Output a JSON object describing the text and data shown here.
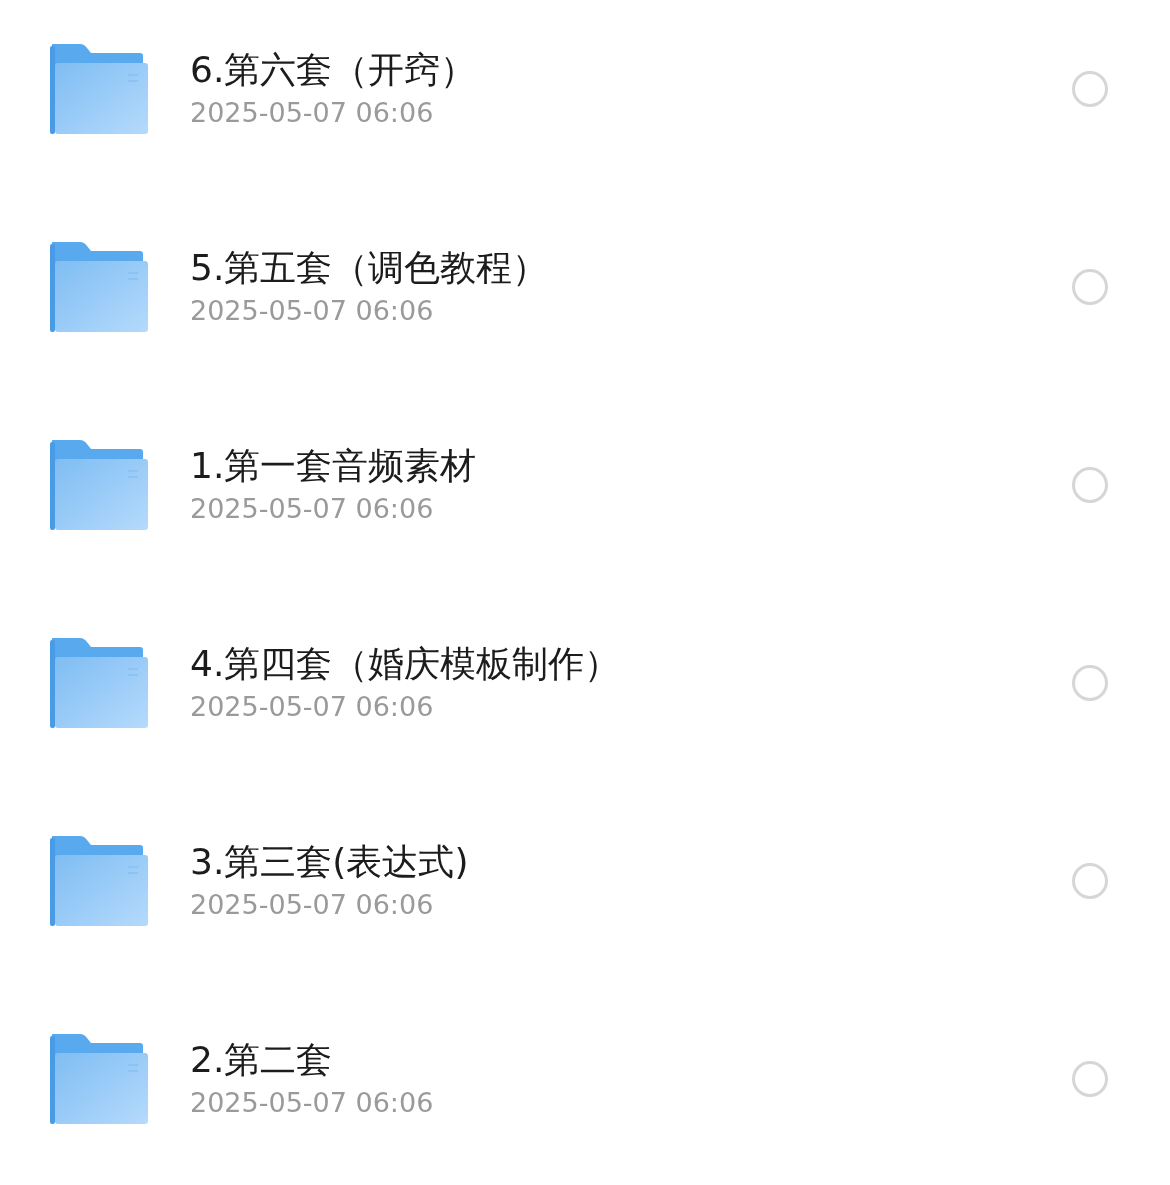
{
  "files": [
    {
      "name": "6.第六套（开窍）",
      "date": "2025-05-07 06:06",
      "selected": false
    },
    {
      "name": "5.第五套（调色教程）",
      "date": "2025-05-07 06:06",
      "selected": false
    },
    {
      "name": "1.第一套音频素材",
      "date": "2025-05-07 06:06",
      "selected": false
    },
    {
      "name": "4.第四套（婚庆模板制作）",
      "date": "2025-05-07 06:06",
      "selected": false
    },
    {
      "name": "3.第三套(表达式)",
      "date": "2025-05-07 06:06",
      "selected": false
    },
    {
      "name": "2.第二套",
      "date": "2025-05-07 06:06",
      "selected": false
    }
  ]
}
